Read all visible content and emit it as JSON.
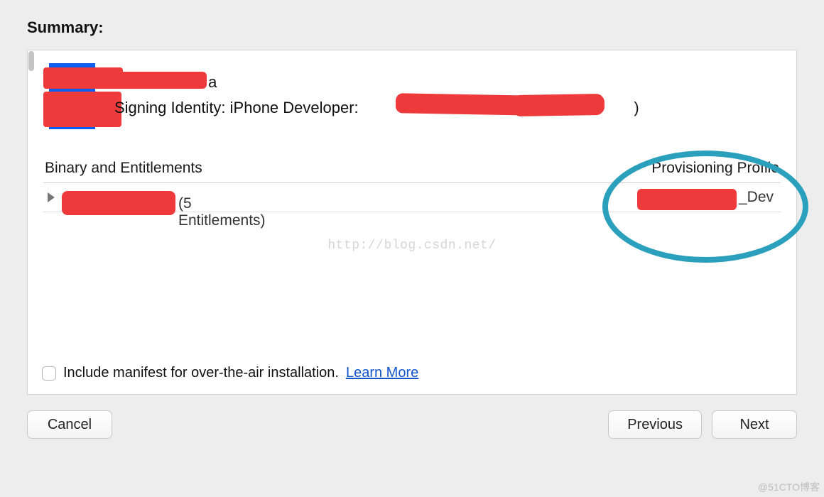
{
  "title": "Summary:",
  "header": {
    "app_name": "a",
    "signing_prefix": "Signing Identity: iPhone Developer: ",
    "signing_tail_close": ")"
  },
  "columns": {
    "left": "Binary and Entitlements",
    "right": "Provisioning Profile"
  },
  "row": {
    "entitlements": "(5 Entitlements)",
    "profile_suffix": "_Dev"
  },
  "watermark": "http://blog.csdn.net/",
  "manifest": {
    "label": "Include manifest for over-the-air installation.",
    "learn_more": "Learn More"
  },
  "buttons": {
    "cancel": "Cancel",
    "previous": "Previous",
    "next": "Next"
  },
  "attribution": "@51CTO博客"
}
